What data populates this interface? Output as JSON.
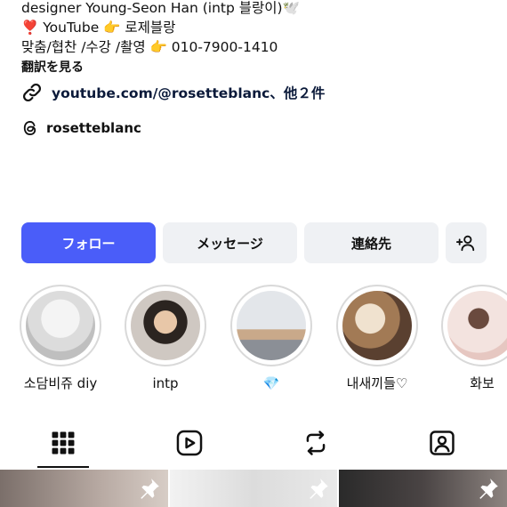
{
  "bio": {
    "line1": "designer Young-Seon Han (intp 블랑이)🕊️",
    "line2": "❣️ YouTube 👉 로제블랑",
    "line3": "맞춤/협찬 /수강 /촬영 👉 010-7900-1410",
    "translate": "翻訳を見る",
    "link": "youtube.com/@rosetteblanc、他２件",
    "threads_handle": "rosetteblanc"
  },
  "actions": {
    "follow": "フォロー",
    "message": "メッセージ",
    "contact": "連絡先",
    "add_user_icon": "add-user-icon"
  },
  "highlights": [
    {
      "label": "소담비쥬 diy"
    },
    {
      "label": "intp"
    },
    {
      "label": "💎"
    },
    {
      "label": "내새끼들♡"
    },
    {
      "label": "화보"
    }
  ],
  "tabs": [
    {
      "icon": "grid-icon",
      "active": true
    },
    {
      "icon": "reels-icon",
      "active": false
    },
    {
      "icon": "reposts-icon",
      "active": false
    },
    {
      "icon": "tagged-icon",
      "active": false
    }
  ],
  "colors": {
    "accent": "#4a5df9",
    "button_bg": "#eff1f4"
  }
}
